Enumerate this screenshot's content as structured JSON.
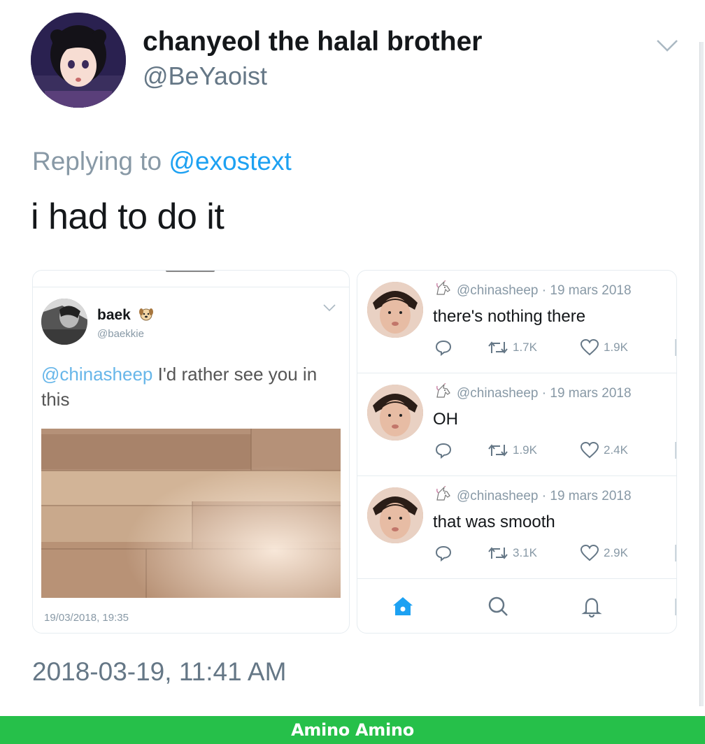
{
  "tweet": {
    "display_name": "chanyeol the halal brother",
    "handle": "@BeYaoist",
    "replying_prefix": "Replying to ",
    "replying_to": "@exostext",
    "text": "i had to do it",
    "timestamp": "2018-03-19, 11:41 AM"
  },
  "left_screenshot": {
    "author_name": "baek",
    "author_handle": "@baekkie",
    "name_emoji_icon": "dog-face-icon",
    "mention": "@chinasheep",
    "text": " I'd rather see you in this",
    "date": "19/03/2018, 19:35"
  },
  "right_screenshot": {
    "replies": [
      {
        "handle": "@chinasheep",
        "date": "19 mars 2018",
        "text": "there's nothing there",
        "retweets": "1.7K",
        "likes": "1.9K"
      },
      {
        "handle": "@chinasheep",
        "date": "19 mars 2018",
        "text": "OH",
        "retweets": "1.9K",
        "likes": "2.4K"
      },
      {
        "handle": "@chinasheep",
        "date": "19 mars 2018",
        "text": "that was smooth",
        "retweets": "3.1K",
        "likes": "2.9K"
      }
    ],
    "nav_icons": [
      "home-icon",
      "search-icon",
      "bell-icon"
    ],
    "home_color": "#1da1f2"
  },
  "footer": {
    "brand": "Amino Amino",
    "color": "#26c04a"
  }
}
